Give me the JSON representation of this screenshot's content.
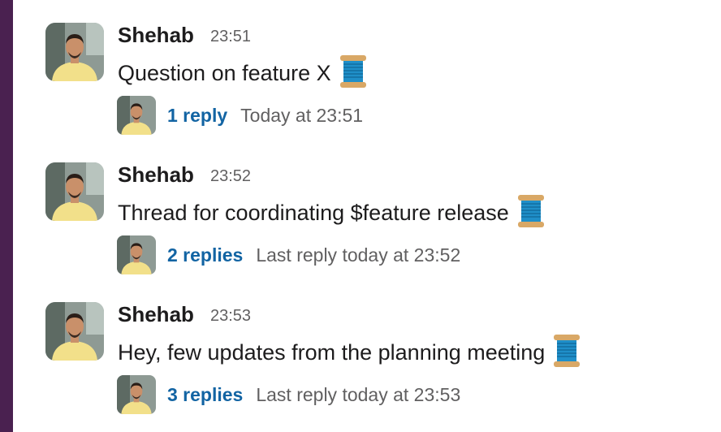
{
  "messages": [
    {
      "author": "Shehab",
      "time": "23:51",
      "text": "Question on feature X",
      "emoji": "thread-spool-icon",
      "thread": {
        "reply_count": "1 reply",
        "last_reply": "Today at 23:51"
      }
    },
    {
      "author": "Shehab",
      "time": "23:52",
      "text": "Thread for coordinating $feature release",
      "emoji": "thread-spool-icon",
      "thread": {
        "reply_count": "2 replies",
        "last_reply": "Last reply today at 23:52"
      }
    },
    {
      "author": "Shehab",
      "time": "23:53",
      "text": "Hey, few updates from the planning meeting",
      "emoji": "thread-spool-icon",
      "thread": {
        "reply_count": "3 replies",
        "last_reply": "Last reply today at 23:53"
      }
    }
  ],
  "colors": {
    "sidebar": "#4a2150",
    "link": "#1264a3",
    "muted": "#616061",
    "text": "#1d1c1d",
    "shirt": "#f2e08a"
  }
}
